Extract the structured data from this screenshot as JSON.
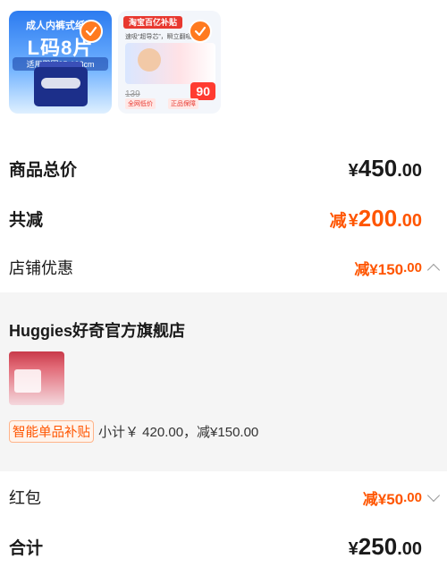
{
  "products": [
    {
      "title_line1": "成人内裤式纸尿",
      "title_line2": "L码8片",
      "title_line3": "适用臀围95-138cm",
      "selected": true
    },
    {
      "banner": "淘宝百亿补贴",
      "sub": "速吸“超导芯”，瞬立翻吸",
      "old_price": "139",
      "new_price": "90",
      "tag1": "全网低价",
      "tag2": "正品保障",
      "selected": true
    }
  ],
  "summary": {
    "total_label": "商品总价",
    "total_yen": "¥",
    "total_int": "450",
    "total_dec": ".00",
    "reduce_label": "共减",
    "reduce_prefix": "减",
    "reduce_yen": "¥",
    "reduce_int": "200",
    "reduce_dec": ".00",
    "store_label": "店铺优惠",
    "store_value": "减¥150",
    "store_dec": ".00"
  },
  "shop": {
    "name": "Huggies好奇官方旗舰店",
    "badge": "智能单品补贴",
    "subtotal": "小计￥ 420.00，减¥150.00"
  },
  "footer": {
    "hongbao_label": "红包",
    "hongbao_value": "减¥50",
    "hongbao_dec": ".00",
    "total_label": "合计",
    "total_yen": "¥",
    "total_int": "250",
    "total_dec": ".00"
  },
  "colors": {
    "accent": "#ff5500",
    "check": "#ff7a1f",
    "shop_bg": "#f5f5f5"
  }
}
